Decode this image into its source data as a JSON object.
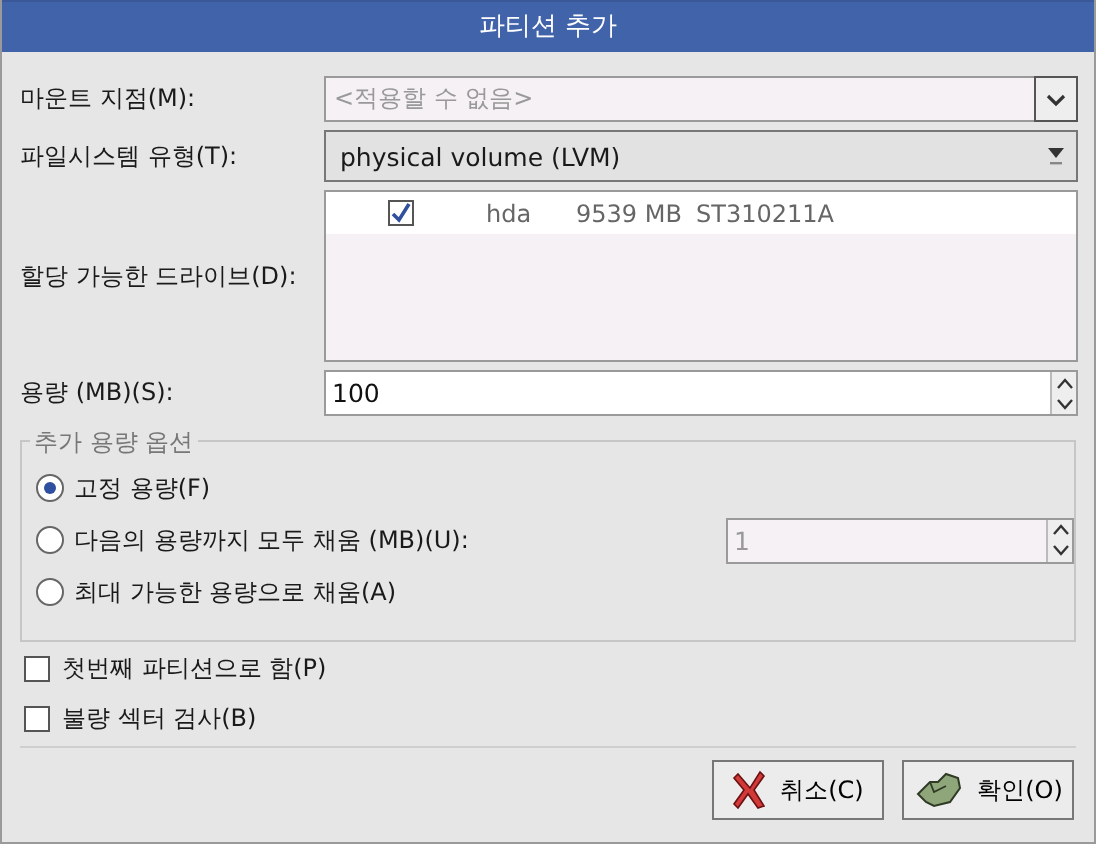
{
  "window": {
    "title": "파티션 추가"
  },
  "mount_point": {
    "label": "마운트 지점(M):",
    "placeholder": "<적용할 수 없음>",
    "disabled": true
  },
  "filesystem_type": {
    "label": "파일시스템 유형(T):",
    "value": "physical volume (LVM)"
  },
  "drives": {
    "label": "할당 가능한 드라이브(D):",
    "rows": [
      {
        "checked": true,
        "name": "hda",
        "size": "9539 MB",
        "model": "ST310211A"
      }
    ]
  },
  "size": {
    "label": "용량 (MB)(S):",
    "value": "100"
  },
  "size_options": {
    "title": "추가 용량 옵션",
    "options": [
      {
        "kind": "plain",
        "label": "고정 용량(F)",
        "selected": true
      },
      {
        "kind": "spin",
        "label": "다음의 용량까지 모두 채움 (MB)(U):",
        "selected": false,
        "value": "1",
        "disabled": true
      },
      {
        "kind": "plain",
        "label": "최대 가능한 용량으로 채움(A)",
        "selected": false
      }
    ]
  },
  "checkboxes": [
    {
      "label": "첫번째 파티션으로 함(P)",
      "checked": false
    },
    {
      "label": "불량 섹터 검사(B)",
      "checked": false
    }
  ],
  "buttons": [
    {
      "kind": "cancel",
      "label": "취소(C)"
    },
    {
      "kind": "ok",
      "label": "확인(O)"
    }
  ]
}
